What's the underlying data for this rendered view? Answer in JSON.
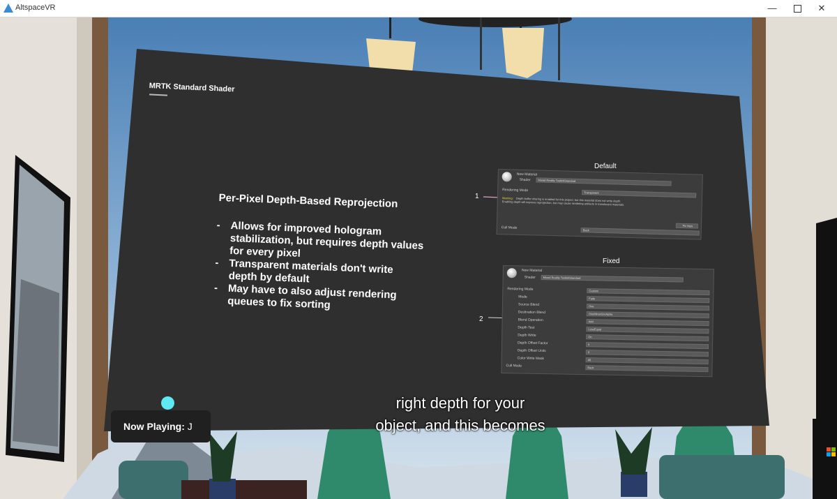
{
  "window": {
    "title": "AltspaceVR",
    "minimize": "—",
    "close": "✕"
  },
  "slide": {
    "title": "MRTK Standard Shader",
    "heading": "Per-Pixel Depth-Based Reprojection",
    "bullets": [
      "Allows for improved hologram stabilization, but requires depth values for every pixel",
      "Transparent materials don't write depth by default",
      "May have to also adjust rendering queues to fix sorting"
    ],
    "bullet_marker": "-",
    "default_label": "Default",
    "fixed_label": "Fixed",
    "callout_1": "1",
    "callout_2": "2"
  },
  "inspector_default": {
    "material": "New Material",
    "shader_label": "Shader",
    "shader_value": "Mixed Reality Toolkit/Standard",
    "rendering_mode_label": "Rendering Mode",
    "rendering_mode_value": "Transparent",
    "warning_label": "Warning:",
    "warning_text": "Depth buffer sharing is enabled for this project, but this material does not write depth.",
    "warning_text_2": "Enabling depth will improve reprojection, but may cause rendering artifacts in translucent materials.",
    "fix_button": "Fix Now",
    "cull_mode_label": "Cull Mode",
    "cull_mode_value": "Back"
  },
  "inspector_fixed": {
    "material": "New Material",
    "shader_label": "Shader",
    "shader_value": "Mixed Reality Toolkit/Standard",
    "rows": [
      {
        "label": "Rendering Mode",
        "value": "Custom"
      },
      {
        "label": "Mode",
        "value": "Fade"
      },
      {
        "label": "Source Blend",
        "value": "One"
      },
      {
        "label": "Destination Blend",
        "value": "OneMinusSrcAlpha"
      },
      {
        "label": "Blend Operation",
        "value": "Add"
      },
      {
        "label": "Depth Test",
        "value": "LessEqual"
      },
      {
        "label": "Depth Write",
        "value": "On"
      },
      {
        "label": "Depth Offset Factor",
        "value": "0"
      },
      {
        "label": "Depth Offset Units",
        "value": "0"
      },
      {
        "label": "Color Write Mask",
        "value": "All"
      },
      {
        "label": "Cull Mode",
        "value": "Back"
      }
    ]
  },
  "caption": {
    "line1": "right depth for your",
    "line2": "object, and this becomes"
  },
  "now_playing": {
    "label": "Now Playing:",
    "value": "J"
  },
  "colors": {
    "screen": "#2f2f2f",
    "indicator_dot": "#5fe9f2",
    "sky": "#7fa8cf",
    "accent_blue": "#3a8ad4"
  }
}
